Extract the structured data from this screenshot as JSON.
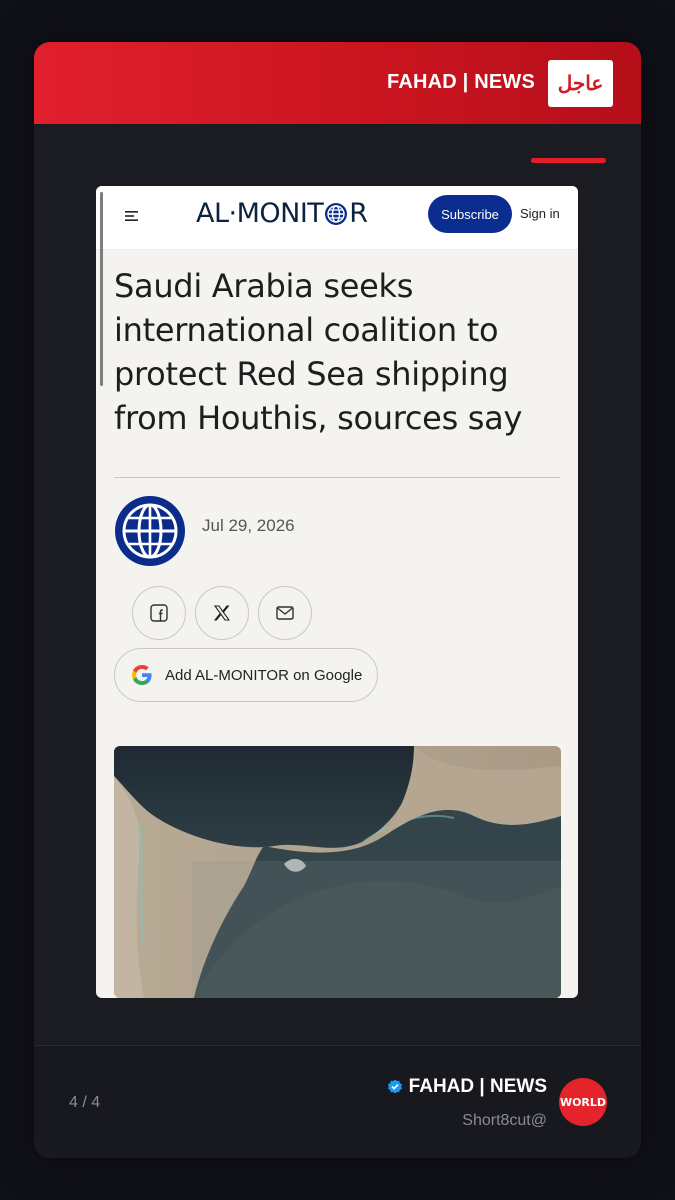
{
  "header": {
    "brand": "FAHAD | NEWS",
    "badge": "عاجل"
  },
  "article": {
    "site_logo_left": "AL·MONIT",
    "site_logo_right": "R",
    "subscribe_label": "Subscribe",
    "signin_label": "Sign in",
    "headline": "Saudi Arabia seeks international coalition to protect Red Sea shipping from Houthis, sources say",
    "date": "Jul 29, 2026",
    "share": [
      "facebook-icon",
      "x-icon",
      "mail-icon"
    ],
    "google_button_label": "Add AL-MONITOR on Google"
  },
  "footer": {
    "page_counter": "4 / 4",
    "name": "FAHAD | NEWS",
    "handle": "Short8cut@",
    "logo_text": "WORLD"
  },
  "colors": {
    "brand_red": "#e0202c",
    "subscribe_blue": "#0b2d8f",
    "verified_blue": "#1d9bf0"
  }
}
